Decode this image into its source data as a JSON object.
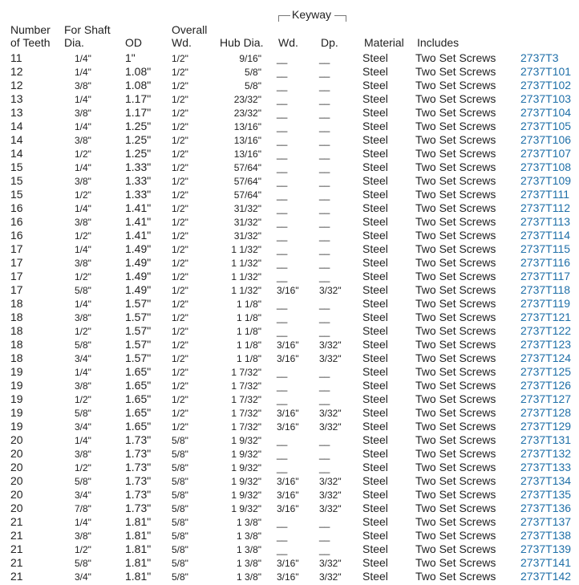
{
  "columns": {
    "teeth": [
      "Number",
      "of Teeth"
    ],
    "shaft": [
      "For Shaft",
      "Dia."
    ],
    "od": "OD",
    "wd": [
      "Overall",
      "Wd."
    ],
    "hub": "Hub Dia.",
    "keyway": "Keyway",
    "kw": "Wd.",
    "kd": "Dp.",
    "material": "Material",
    "includes": "Includes"
  },
  "rows": [
    {
      "teeth": "11",
      "shaft": "1/4\"",
      "od": "1\"",
      "wd": "1/2\"",
      "hub": "9/16\"",
      "kw": "__",
      "kd": "__",
      "material": "Steel",
      "includes": "Two Set Screws",
      "part": "2737T3"
    },
    {
      "teeth": "12",
      "shaft": "1/4\"",
      "od": "1.08\"",
      "wd": "1/2\"",
      "hub": "5/8\"",
      "kw": "__",
      "kd": "__",
      "material": "Steel",
      "includes": "Two Set Screws",
      "part": "2737T101"
    },
    {
      "teeth": "12",
      "shaft": "3/8\"",
      "od": "1.08\"",
      "wd": "1/2\"",
      "hub": "5/8\"",
      "kw": "__",
      "kd": "__",
      "material": "Steel",
      "includes": "Two Set Screws",
      "part": "2737T102"
    },
    {
      "teeth": "13",
      "shaft": "1/4\"",
      "od": "1.17\"",
      "wd": "1/2\"",
      "hub": "23/32\"",
      "kw": "__",
      "kd": "__",
      "material": "Steel",
      "includes": "Two Set Screws",
      "part": "2737T103"
    },
    {
      "teeth": "13",
      "shaft": "3/8\"",
      "od": "1.17\"",
      "wd": "1/2\"",
      "hub": "23/32\"",
      "kw": "__",
      "kd": "__",
      "material": "Steel",
      "includes": "Two Set Screws",
      "part": "2737T104"
    },
    {
      "teeth": "14",
      "shaft": "1/4\"",
      "od": "1.25\"",
      "wd": "1/2\"",
      "hub": "13/16\"",
      "kw": "__",
      "kd": "__",
      "material": "Steel",
      "includes": "Two Set Screws",
      "part": "2737T105"
    },
    {
      "teeth": "14",
      "shaft": "3/8\"",
      "od": "1.25\"",
      "wd": "1/2\"",
      "hub": "13/16\"",
      "kw": "__",
      "kd": "__",
      "material": "Steel",
      "includes": "Two Set Screws",
      "part": "2737T106"
    },
    {
      "teeth": "14",
      "shaft": "1/2\"",
      "od": "1.25\"",
      "wd": "1/2\"",
      "hub": "13/16\"",
      "kw": "__",
      "kd": "__",
      "material": "Steel",
      "includes": "Two Set Screws",
      "part": "2737T107"
    },
    {
      "teeth": "15",
      "shaft": "1/4\"",
      "od": "1.33\"",
      "wd": "1/2\"",
      "hub": "57/64\"",
      "kw": "__",
      "kd": "__",
      "material": "Steel",
      "includes": "Two Set Screws",
      "part": "2737T108"
    },
    {
      "teeth": "15",
      "shaft": "3/8\"",
      "od": "1.33\"",
      "wd": "1/2\"",
      "hub": "57/64\"",
      "kw": "__",
      "kd": "__",
      "material": "Steel",
      "includes": "Two Set Screws",
      "part": "2737T109"
    },
    {
      "teeth": "15",
      "shaft": "1/2\"",
      "od": "1.33\"",
      "wd": "1/2\"",
      "hub": "57/64\"",
      "kw": "__",
      "kd": "__",
      "material": "Steel",
      "includes": "Two Set Screws",
      "part": "2737T111"
    },
    {
      "teeth": "16",
      "shaft": "1/4\"",
      "od": "1.41\"",
      "wd": "1/2\"",
      "hub": "31/32\"",
      "kw": "__",
      "kd": "__",
      "material": "Steel",
      "includes": "Two Set Screws",
      "part": "2737T112"
    },
    {
      "teeth": "16",
      "shaft": "3/8\"",
      "od": "1.41\"",
      "wd": "1/2\"",
      "hub": "31/32\"",
      "kw": "__",
      "kd": "__",
      "material": "Steel",
      "includes": "Two Set Screws",
      "part": "2737T113"
    },
    {
      "teeth": "16",
      "shaft": "1/2\"",
      "od": "1.41\"",
      "wd": "1/2\"",
      "hub": "31/32\"",
      "kw": "__",
      "kd": "__",
      "material": "Steel",
      "includes": "Two Set Screws",
      "part": "2737T114"
    },
    {
      "teeth": "17",
      "shaft": "1/4\"",
      "od": "1.49\"",
      "wd": "1/2\"",
      "hub": "1 1/32\"",
      "kw": "__",
      "kd": "__",
      "material": "Steel",
      "includes": "Two Set Screws",
      "part": "2737T115"
    },
    {
      "teeth": "17",
      "shaft": "3/8\"",
      "od": "1.49\"",
      "wd": "1/2\"",
      "hub": "1 1/32\"",
      "kw": "__",
      "kd": "__",
      "material": "Steel",
      "includes": "Two Set Screws",
      "part": "2737T116"
    },
    {
      "teeth": "17",
      "shaft": "1/2\"",
      "od": "1.49\"",
      "wd": "1/2\"",
      "hub": "1 1/32\"",
      "kw": "__",
      "kd": "__",
      "material": "Steel",
      "includes": "Two Set Screws",
      "part": "2737T117"
    },
    {
      "teeth": "17",
      "shaft": "5/8\"",
      "od": "1.49\"",
      "wd": "1/2\"",
      "hub": "1 1/32\"",
      "kw": "3/16\"",
      "kd": "3/32\"",
      "material": "Steel",
      "includes": "Two Set Screws",
      "part": "2737T118"
    },
    {
      "teeth": "18",
      "shaft": "1/4\"",
      "od": "1.57\"",
      "wd": "1/2\"",
      "hub": "1 1/8\"",
      "kw": "__",
      "kd": "__",
      "material": "Steel",
      "includes": "Two Set Screws",
      "part": "2737T119"
    },
    {
      "teeth": "18",
      "shaft": "3/8\"",
      "od": "1.57\"",
      "wd": "1/2\"",
      "hub": "1 1/8\"",
      "kw": "__",
      "kd": "__",
      "material": "Steel",
      "includes": "Two Set Screws",
      "part": "2737T121"
    },
    {
      "teeth": "18",
      "shaft": "1/2\"",
      "od": "1.57\"",
      "wd": "1/2\"",
      "hub": "1 1/8\"",
      "kw": "__",
      "kd": "__",
      "material": "Steel",
      "includes": "Two Set Screws",
      "part": "2737T122"
    },
    {
      "teeth": "18",
      "shaft": "5/8\"",
      "od": "1.57\"",
      "wd": "1/2\"",
      "hub": "1 1/8\"",
      "kw": "3/16\"",
      "kd": "3/32\"",
      "material": "Steel",
      "includes": "Two Set Screws",
      "part": "2737T123"
    },
    {
      "teeth": "18",
      "shaft": "3/4\"",
      "od": "1.57\"",
      "wd": "1/2\"",
      "hub": "1 1/8\"",
      "kw": "3/16\"",
      "kd": "3/32\"",
      "material": "Steel",
      "includes": "Two Set Screws",
      "part": "2737T124"
    },
    {
      "teeth": "19",
      "shaft": "1/4\"",
      "od": "1.65\"",
      "wd": "1/2\"",
      "hub": "1 7/32\"",
      "kw": "__",
      "kd": "__",
      "material": "Steel",
      "includes": "Two Set Screws",
      "part": "2737T125"
    },
    {
      "teeth": "19",
      "shaft": "3/8\"",
      "od": "1.65\"",
      "wd": "1/2\"",
      "hub": "1 7/32\"",
      "kw": "__",
      "kd": "__",
      "material": "Steel",
      "includes": "Two Set Screws",
      "part": "2737T126"
    },
    {
      "teeth": "19",
      "shaft": "1/2\"",
      "od": "1.65\"",
      "wd": "1/2\"",
      "hub": "1 7/32\"",
      "kw": "__",
      "kd": "__",
      "material": "Steel",
      "includes": "Two Set Screws",
      "part": "2737T127"
    },
    {
      "teeth": "19",
      "shaft": "5/8\"",
      "od": "1.65\"",
      "wd": "1/2\"",
      "hub": "1 7/32\"",
      "kw": "3/16\"",
      "kd": "3/32\"",
      "material": "Steel",
      "includes": "Two Set Screws",
      "part": "2737T128"
    },
    {
      "teeth": "19",
      "shaft": "3/4\"",
      "od": "1.65\"",
      "wd": "1/2\"",
      "hub": "1 7/32\"",
      "kw": "3/16\"",
      "kd": "3/32\"",
      "material": "Steel",
      "includes": "Two Set Screws",
      "part": "2737T129"
    },
    {
      "teeth": "20",
      "shaft": "1/4\"",
      "od": "1.73\"",
      "wd": "5/8\"",
      "hub": "1 9/32\"",
      "kw": "__",
      "kd": "__",
      "material": "Steel",
      "includes": "Two Set Screws",
      "part": "2737T131"
    },
    {
      "teeth": "20",
      "shaft": "3/8\"",
      "od": "1.73\"",
      "wd": "5/8\"",
      "hub": "1 9/32\"",
      "kw": "__",
      "kd": "__",
      "material": "Steel",
      "includes": "Two Set Screws",
      "part": "2737T132"
    },
    {
      "teeth": "20",
      "shaft": "1/2\"",
      "od": "1.73\"",
      "wd": "5/8\"",
      "hub": "1 9/32\"",
      "kw": "__",
      "kd": "__",
      "material": "Steel",
      "includes": "Two Set Screws",
      "part": "2737T133"
    },
    {
      "teeth": "20",
      "shaft": "5/8\"",
      "od": "1.73\"",
      "wd": "5/8\"",
      "hub": "1 9/32\"",
      "kw": "3/16\"",
      "kd": "3/32\"",
      "material": "Steel",
      "includes": "Two Set Screws",
      "part": "2737T134"
    },
    {
      "teeth": "20",
      "shaft": "3/4\"",
      "od": "1.73\"",
      "wd": "5/8\"",
      "hub": "1 9/32\"",
      "kw": "3/16\"",
      "kd": "3/32\"",
      "material": "Steel",
      "includes": "Two Set Screws",
      "part": "2737T135"
    },
    {
      "teeth": "20",
      "shaft": "7/8\"",
      "od": "1.73\"",
      "wd": "5/8\"",
      "hub": "1 9/32\"",
      "kw": "3/16\"",
      "kd": "3/32\"",
      "material": "Steel",
      "includes": "Two Set Screws",
      "part": "2737T136"
    },
    {
      "teeth": "21",
      "shaft": "1/4\"",
      "od": "1.81\"",
      "wd": "5/8\"",
      "hub": "1 3/8\"",
      "kw": "__",
      "kd": "__",
      "material": "Steel",
      "includes": "Two Set Screws",
      "part": "2737T137"
    },
    {
      "teeth": "21",
      "shaft": "3/8\"",
      "od": "1.81\"",
      "wd": "5/8\"",
      "hub": "1 3/8\"",
      "kw": "__",
      "kd": "__",
      "material": "Steel",
      "includes": "Two Set Screws",
      "part": "2737T138"
    },
    {
      "teeth": "21",
      "shaft": "1/2\"",
      "od": "1.81\"",
      "wd": "5/8\"",
      "hub": "1 3/8\"",
      "kw": "__",
      "kd": "__",
      "material": "Steel",
      "includes": "Two Set Screws",
      "part": "2737T139"
    },
    {
      "teeth": "21",
      "shaft": "5/8\"",
      "od": "1.81\"",
      "wd": "5/8\"",
      "hub": "1 3/8\"",
      "kw": "3/16\"",
      "kd": "3/32\"",
      "material": "Steel",
      "includes": "Two Set Screws",
      "part": "2737T141"
    },
    {
      "teeth": "21",
      "shaft": "3/4\"",
      "od": "1.81\"",
      "wd": "5/8\"",
      "hub": "1 3/8\"",
      "kw": "3/16\"",
      "kd": "3/32\"",
      "material": "Steel",
      "includes": "Two Set Screws",
      "part": "2737T142"
    }
  ]
}
